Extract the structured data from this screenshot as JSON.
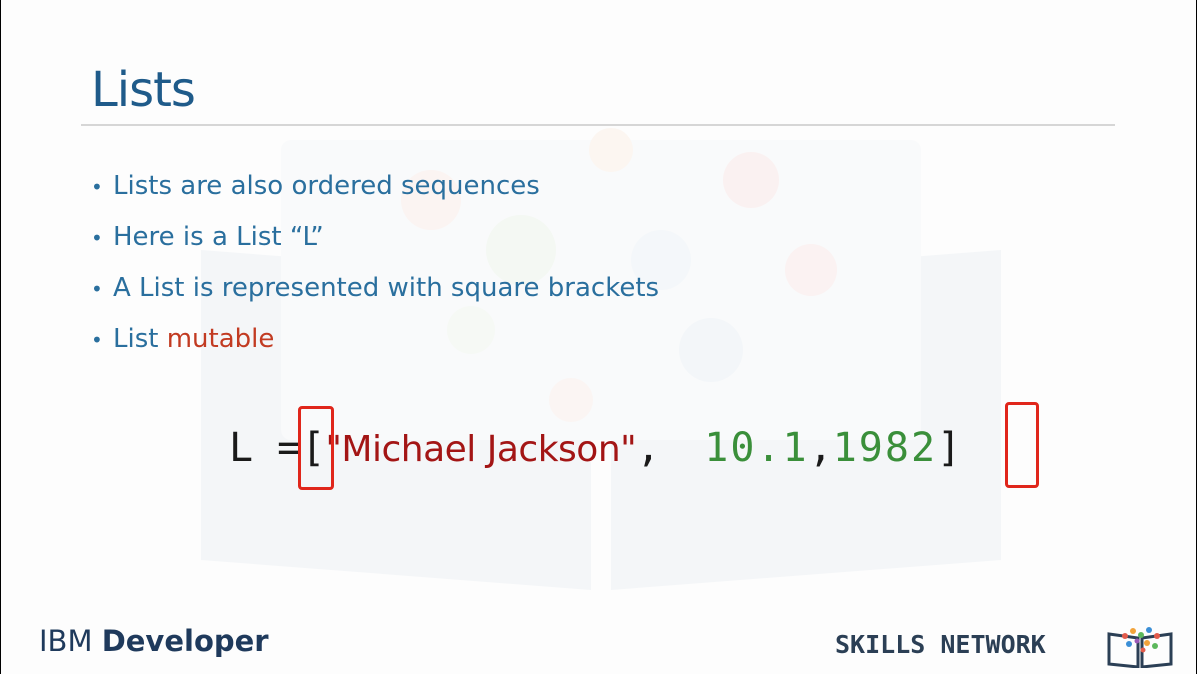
{
  "slide": {
    "title": "Lists",
    "bullets": [
      {
        "text": "Lists are also ordered sequences"
      },
      {
        "text": "Here is a List “L”"
      },
      {
        "text": "A List is  represented with square brackets"
      },
      {
        "text": "List ",
        "highlight": "mutable"
      }
    ],
    "code": {
      "lhs": "L =",
      "open_bracket": "[",
      "string_value": "\"Michael Jackson\"",
      "comma1": ",",
      "number1": "10.1",
      "comma2": ",",
      "number2": "1982",
      "close_bracket": "]"
    },
    "footer": {
      "brand_ibm": "IBM",
      "brand_developer": "Developer",
      "skills_network": "SKILLS NETWORK"
    },
    "colors": {
      "title": "#1f5b8a",
      "bullet_text": "#2a6f9e",
      "highlight": "#c23b22",
      "string": "#a31515",
      "number": "#3a8f3a",
      "bracket_box": "#e0261b"
    }
  }
}
